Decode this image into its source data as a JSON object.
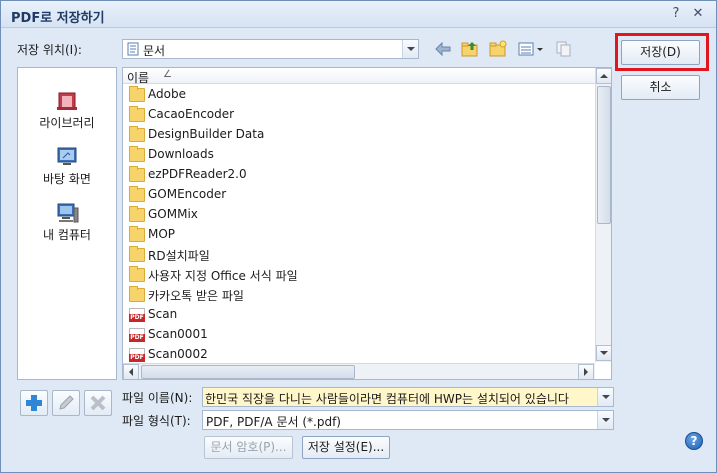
{
  "window": {
    "title": "PDF로 저장하기",
    "help_glyph": "?",
    "close_glyph": "✕"
  },
  "location": {
    "label": "저장 위치(I):",
    "value": "문서"
  },
  "places": [
    {
      "label": "라이브러리",
      "icon": "library-icon"
    },
    {
      "label": "바탕 화면",
      "icon": "desktop-icon"
    },
    {
      "label": "내 컴퓨터",
      "icon": "computer-icon"
    }
  ],
  "filelist": {
    "column_header": "이름",
    "sort_indicator": "∠",
    "items": [
      {
        "name": "Adobe",
        "type": "folder"
      },
      {
        "name": "CacaoEncoder",
        "type": "folder"
      },
      {
        "name": "DesignBuilder Data",
        "type": "folder"
      },
      {
        "name": "Downloads",
        "type": "folder"
      },
      {
        "name": "ezPDFReader2.0",
        "type": "folder"
      },
      {
        "name": "GOMEncoder",
        "type": "folder"
      },
      {
        "name": "GOMMix",
        "type": "folder"
      },
      {
        "name": "MOP",
        "type": "folder"
      },
      {
        "name": "RD설치파일",
        "type": "folder"
      },
      {
        "name": "사용자 지정 Office 서식 파일",
        "type": "folder"
      },
      {
        "name": "카카오톡 받은 파일",
        "type": "folder"
      },
      {
        "name": "Scan",
        "type": "pdf"
      },
      {
        "name": "Scan0001",
        "type": "pdf"
      },
      {
        "name": "Scan0002",
        "type": "pdf"
      }
    ]
  },
  "filename": {
    "label": "파일 이름(N):",
    "value": "한민국 직장을 다니는 사람들이라면 컴퓨터에 HWP는 설치되어 있습니다"
  },
  "filetype": {
    "label": "파일 형식(T):",
    "value": "PDF, PDF/A 문서 (*.pdf)"
  },
  "buttons": {
    "save": "저장(D)",
    "cancel": "취소",
    "password": "문서 암호(P)...",
    "save_settings": "저장 설정(E)..."
  },
  "colors": {
    "highlight": "#e0151d",
    "accent": "#1d5fb4"
  }
}
